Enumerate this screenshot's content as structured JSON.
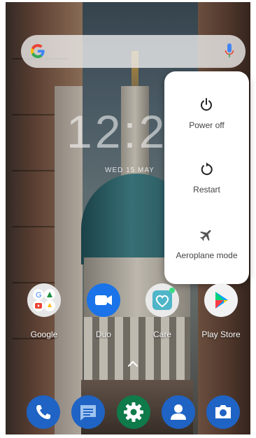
{
  "search_bar": {
    "google_logo": "G"
  },
  "clock": {
    "time": "12:2",
    "date": "WED 15 MAY"
  },
  "power_menu": {
    "items": [
      {
        "label": "Power off",
        "icon": "power-icon"
      },
      {
        "label": "Restart",
        "icon": "restart-icon"
      },
      {
        "label": "Aeroplane mode",
        "icon": "airplane-icon"
      }
    ]
  },
  "apps": [
    {
      "label": "Google",
      "icon": "google-folder-icon"
    },
    {
      "label": "Duo",
      "icon": "duo-icon"
    },
    {
      "label": "Care",
      "icon": "care-icon"
    },
    {
      "label": "Play Store",
      "icon": "play-store-icon"
    }
  ],
  "dock": [
    {
      "icon": "phone-icon"
    },
    {
      "icon": "messages-icon"
    },
    {
      "icon": "settings-icon"
    },
    {
      "icon": "contacts-icon"
    },
    {
      "icon": "camera-icon"
    }
  ],
  "colors": {
    "dock_blue": "#1f63c4",
    "settings_green": "#0f7a4a",
    "menu_bg": "#ffffff",
    "menu_text": "#444444"
  }
}
